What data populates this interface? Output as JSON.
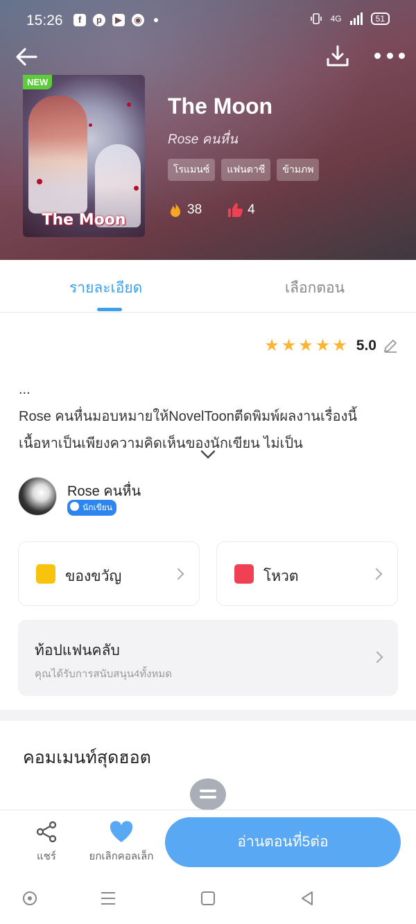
{
  "status_bar": {
    "time": "15:26",
    "app_icons": [
      "facebook-icon",
      "pinterest-icon",
      "youtube-icon",
      "chrome-icon"
    ],
    "network": "4G",
    "battery": "51"
  },
  "book": {
    "badge": "NEW",
    "cover_text": "The Moon",
    "title": "The Moon",
    "author": "Rose คนหื่น",
    "tags": [
      "โรแมนซ์",
      "แฟนตาซี",
      "ข้ามภพ"
    ],
    "fire_count": "38",
    "like_count": "4"
  },
  "tabs": {
    "detail": "รายละเอียด",
    "episodes": "เลือกตอน",
    "active": "detail"
  },
  "rating": {
    "stars": 5,
    "value": "5.0"
  },
  "description": {
    "ellipsis": "...",
    "text": "Rose คนหื่นมอบหมายให้NovelToonตีดพิมพ์ผลงานเรื่องนี้ เนื้อหาเป็นเพียงความคิดเห็นของนักเขียน ไม่เป็น"
  },
  "author_info": {
    "name": "Rose คนหื่น",
    "badge": "นักเขียน"
  },
  "cards": {
    "gift": "ของขวัญ",
    "vote": "โหวต"
  },
  "fanclub": {
    "title": "ท้อปแฟนคลับ",
    "subtitle": "คุณได้รับการสนับสนุน4ทั้งหมด"
  },
  "comments": {
    "heading": "คอมเมนท์สุดฮอต"
  },
  "bottom_bar": {
    "share": "แชร์",
    "favorite": "ยกเลิกคอลเล็ก",
    "read": "อ่านตอนที่5ต่อ"
  },
  "colors": {
    "accent": "#3ea0e8",
    "button": "#58a8f4",
    "new_badge": "#5ccc3b",
    "star": "#fbb433"
  }
}
